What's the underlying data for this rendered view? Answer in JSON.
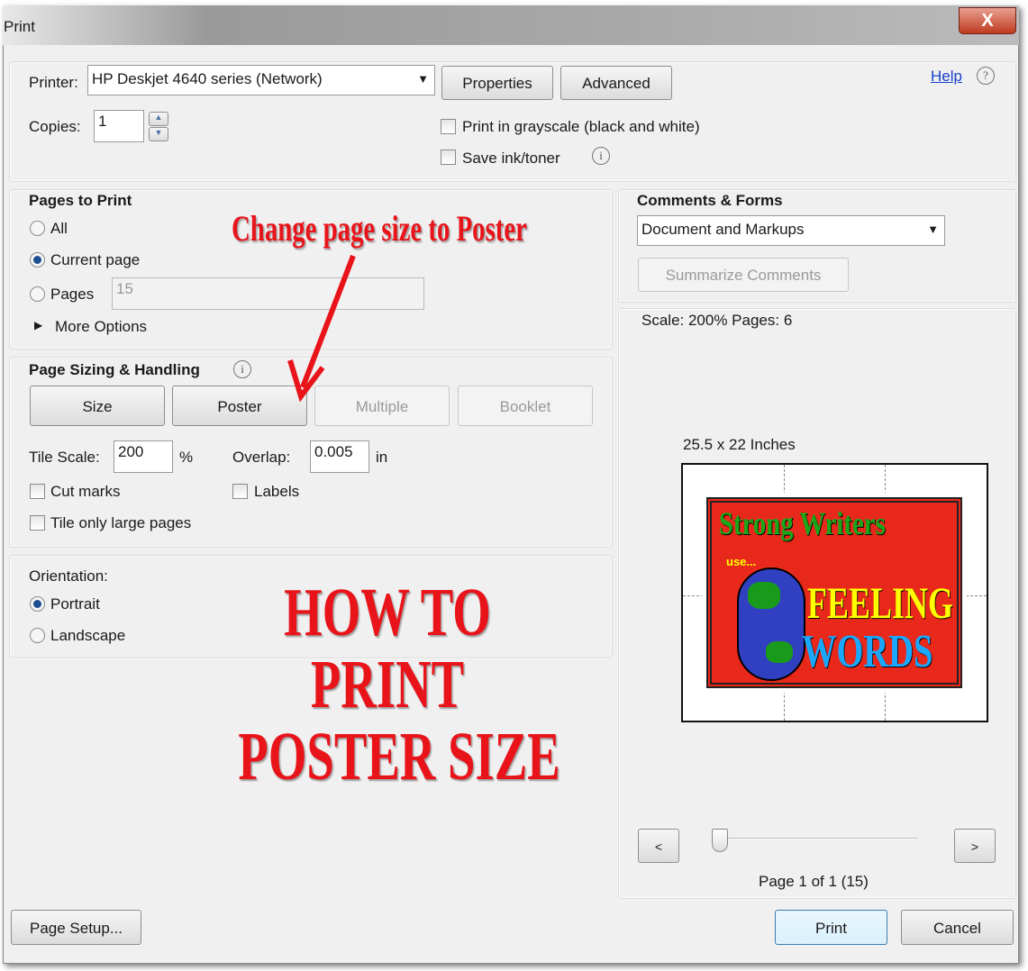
{
  "window": {
    "title": "Print",
    "close_label": "X"
  },
  "printer": {
    "label": "Printer:",
    "value": "HP Deskjet 4640 series (Network)",
    "properties": "Properties",
    "advanced": "Advanced",
    "help": "Help",
    "copies_label": "Copies:",
    "copies": "1",
    "grayscale": "Print in grayscale (black and white)",
    "save_ink": "Save ink/toner"
  },
  "pages": {
    "title": "Pages to Print",
    "all": "All",
    "current": "Current page",
    "pages": "Pages",
    "pages_value": "15",
    "more": "More Options",
    "selected": "Current page"
  },
  "sizing": {
    "title": "Page Sizing & Handling",
    "size": "Size",
    "poster": "Poster",
    "multiple": "Multiple",
    "booklet": "Booklet",
    "tile_label": "Tile Scale:",
    "tile": "200",
    "pct": "%",
    "overlap_label": "Overlap:",
    "overlap": "0.005",
    "unit": "in",
    "cut": "Cut marks",
    "labels": "Labels",
    "tile_large": "Tile only large pages"
  },
  "orientation": {
    "title": "Orientation:",
    "portrait": "Portrait",
    "landscape": "Landscape",
    "selected": "Portrait"
  },
  "comments": {
    "title": "Comments & Forms",
    "value": "Document and Markups",
    "summarize": "Summarize Comments"
  },
  "preview": {
    "scale": "Scale: 200% Pages: 6",
    "dimensions": "25.5 x 22 Inches",
    "prev": "<",
    "next": ">",
    "page": "Page 1 of 1 (15)",
    "poster_line1": "Strong Writers",
    "poster_use": "use...",
    "poster_line2": "FEELING",
    "poster_line3": "WORDS"
  },
  "footer": {
    "page_setup": "Page Setup...",
    "print": "Print",
    "cancel": "Cancel"
  },
  "annotations": {
    "arrow_note": "Change page size to Poster",
    "headline1": "HOW TO",
    "headline2": "PRINT",
    "headline3": "POSTER SIZE"
  },
  "colors": {
    "annotation": "#e8141a",
    "accent": "#1d4f91"
  }
}
